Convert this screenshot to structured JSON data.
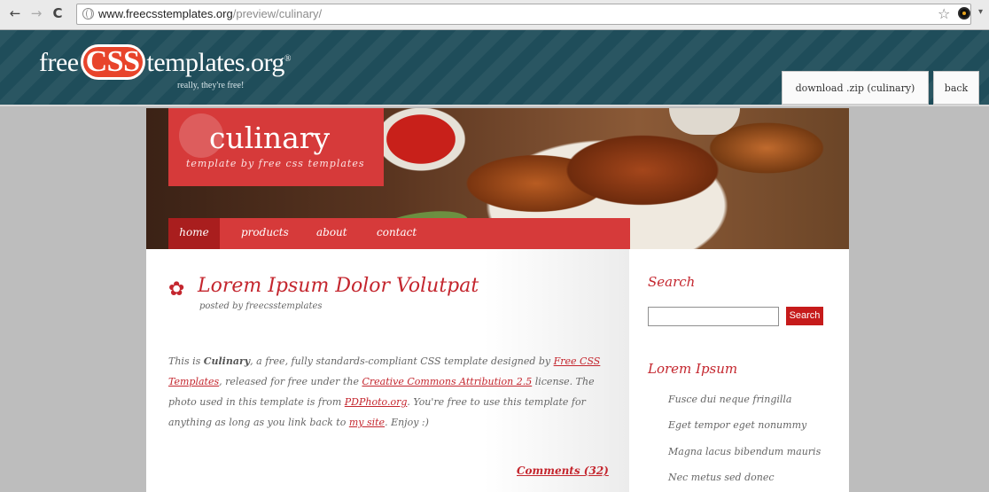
{
  "browser": {
    "url_host": "www.freecsstemplates.org",
    "url_path": "/preview/culinary/",
    "back_glyph": "←",
    "forward_glyph": "→",
    "reload_glyph": "C",
    "star_glyph": "☆",
    "menu_glyph": "▾"
  },
  "site_header": {
    "logo_pre": "free",
    "logo_css": "CSS",
    "logo_post": "templates.org",
    "logo_reg": "®",
    "tagline": "really, they're free!",
    "download_label": "download .zip (culinary)",
    "back_label": "back"
  },
  "template": {
    "brand_name": "culinary",
    "brand_tag": "template by free css templates",
    "menu": [
      {
        "label": "home",
        "active": true
      },
      {
        "label": "products"
      },
      {
        "label": "about"
      },
      {
        "label": "contact"
      }
    ],
    "post": {
      "title": "Lorem Ipsum Dolor Volutpat",
      "meta": "posted by freecsstemplates",
      "body_1": "This is ",
      "body_bold": "Culinary",
      "body_2": ", a free, fully standards-compliant CSS template designed by ",
      "link_fct": "Free CSS Templates",
      "body_3": ", released for free under the ",
      "link_cc": "Creative Commons Attribution 2.5",
      "body_4": " license. The photo used in this template is from ",
      "link_pd": "PDPhoto.org",
      "body_5": ". You're free to use this template for anything as long as you link back to ",
      "link_site": "my site",
      "body_6": ". Enjoy :)",
      "comments": "Comments (32)"
    },
    "sidebar": {
      "search_title": "Search",
      "search_button": "Search",
      "search_value": "",
      "list_title": "Lorem Ipsum",
      "items": [
        "Fusce dui neque fringilla",
        "Eget tempor eget nonummy",
        "Magna lacus bibendum mauris",
        "Nec metus sed donec"
      ]
    }
  }
}
